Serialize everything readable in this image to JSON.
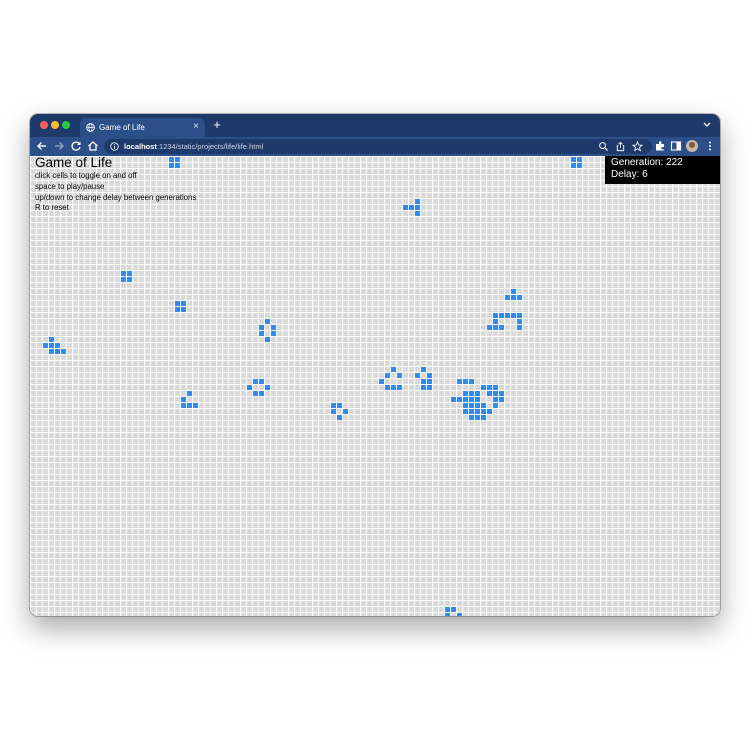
{
  "browser": {
    "tab_title": "Game of Life",
    "url_host": "localhost",
    "url_rest": ":1234/static/projects/life/life.html"
  },
  "page": {
    "heading": "Game of Life",
    "instructions": [
      "click cells to toggle on and off",
      "space to play/pause",
      "up/down to change delay between generations",
      "R to reset"
    ]
  },
  "status": {
    "generation": "Generation: 222",
    "delay": "Delay: 6"
  },
  "grid": {
    "columns": 115,
    "rows": 77,
    "cell_color": "#d9d9d9",
    "live_color": "#2d8cf0",
    "line_color": "#ffffff",
    "live_cells": [
      [
        23,
        0
      ],
      [
        24,
        0
      ],
      [
        23,
        1
      ],
      [
        24,
        1
      ],
      [
        90,
        0
      ],
      [
        91,
        0
      ],
      [
        90,
        1
      ],
      [
        91,
        1
      ],
      [
        64,
        7
      ],
      [
        63,
        8
      ],
      [
        64,
        8
      ],
      [
        62,
        8
      ],
      [
        64,
        9
      ],
      [
        15,
        19
      ],
      [
        16,
        19
      ],
      [
        15,
        20
      ],
      [
        16,
        20
      ],
      [
        24,
        24
      ],
      [
        25,
        24
      ],
      [
        24,
        25
      ],
      [
        25,
        25
      ],
      [
        80,
        22
      ],
      [
        79,
        23
      ],
      [
        80,
        23
      ],
      [
        81,
        23
      ],
      [
        77,
        26
      ],
      [
        78,
        26
      ],
      [
        80,
        26
      ],
      [
        81,
        26
      ],
      [
        79,
        26
      ],
      [
        77,
        27
      ],
      [
        81,
        27
      ],
      [
        76,
        28
      ],
      [
        77,
        28
      ],
      [
        78,
        28
      ],
      [
        81,
        28
      ],
      [
        39,
        27
      ],
      [
        38,
        28
      ],
      [
        40,
        28
      ],
      [
        38,
        29
      ],
      [
        40,
        29
      ],
      [
        39,
        30
      ],
      [
        3,
        30
      ],
      [
        2,
        31
      ],
      [
        3,
        31
      ],
      [
        4,
        31
      ],
      [
        3,
        32
      ],
      [
        4,
        32
      ],
      [
        5,
        32
      ],
      [
        60,
        35
      ],
      [
        59,
        36
      ],
      [
        61,
        36
      ],
      [
        58,
        37
      ],
      [
        59,
        38
      ],
      [
        60,
        38
      ],
      [
        61,
        38
      ],
      [
        65,
        35
      ],
      [
        64,
        36
      ],
      [
        66,
        36
      ],
      [
        65,
        37
      ],
      [
        66,
        37
      ],
      [
        65,
        38
      ],
      [
        66,
        38
      ],
      [
        71,
        37
      ],
      [
        72,
        37
      ],
      [
        73,
        37
      ],
      [
        75,
        38
      ],
      [
        76,
        38
      ],
      [
        77,
        38
      ],
      [
        72,
        39
      ],
      [
        73,
        39
      ],
      [
        74,
        39
      ],
      [
        76,
        39
      ],
      [
        77,
        39
      ],
      [
        78,
        39
      ],
      [
        70,
        40
      ],
      [
        71,
        40
      ],
      [
        72,
        40
      ],
      [
        73,
        40
      ],
      [
        74,
        40
      ],
      [
        77,
        40
      ],
      [
        78,
        40
      ],
      [
        72,
        41
      ],
      [
        73,
        41
      ],
      [
        74,
        41
      ],
      [
        75,
        41
      ],
      [
        77,
        41
      ],
      [
        72,
        42
      ],
      [
        73,
        42
      ],
      [
        74,
        42
      ],
      [
        75,
        42
      ],
      [
        76,
        42
      ],
      [
        73,
        43
      ],
      [
        74,
        43
      ],
      [
        75,
        43
      ],
      [
        37,
        37
      ],
      [
        38,
        37
      ],
      [
        36,
        38
      ],
      [
        39,
        38
      ],
      [
        37,
        39
      ],
      [
        38,
        39
      ],
      [
        26,
        39
      ],
      [
        25,
        40
      ],
      [
        25,
        41
      ],
      [
        26,
        41
      ],
      [
        27,
        41
      ],
      [
        50,
        41
      ],
      [
        51,
        41
      ],
      [
        50,
        42
      ],
      [
        52,
        42
      ],
      [
        51,
        43
      ],
      [
        69,
        75
      ],
      [
        70,
        75
      ],
      [
        69,
        76
      ],
      [
        71,
        76
      ]
    ]
  }
}
